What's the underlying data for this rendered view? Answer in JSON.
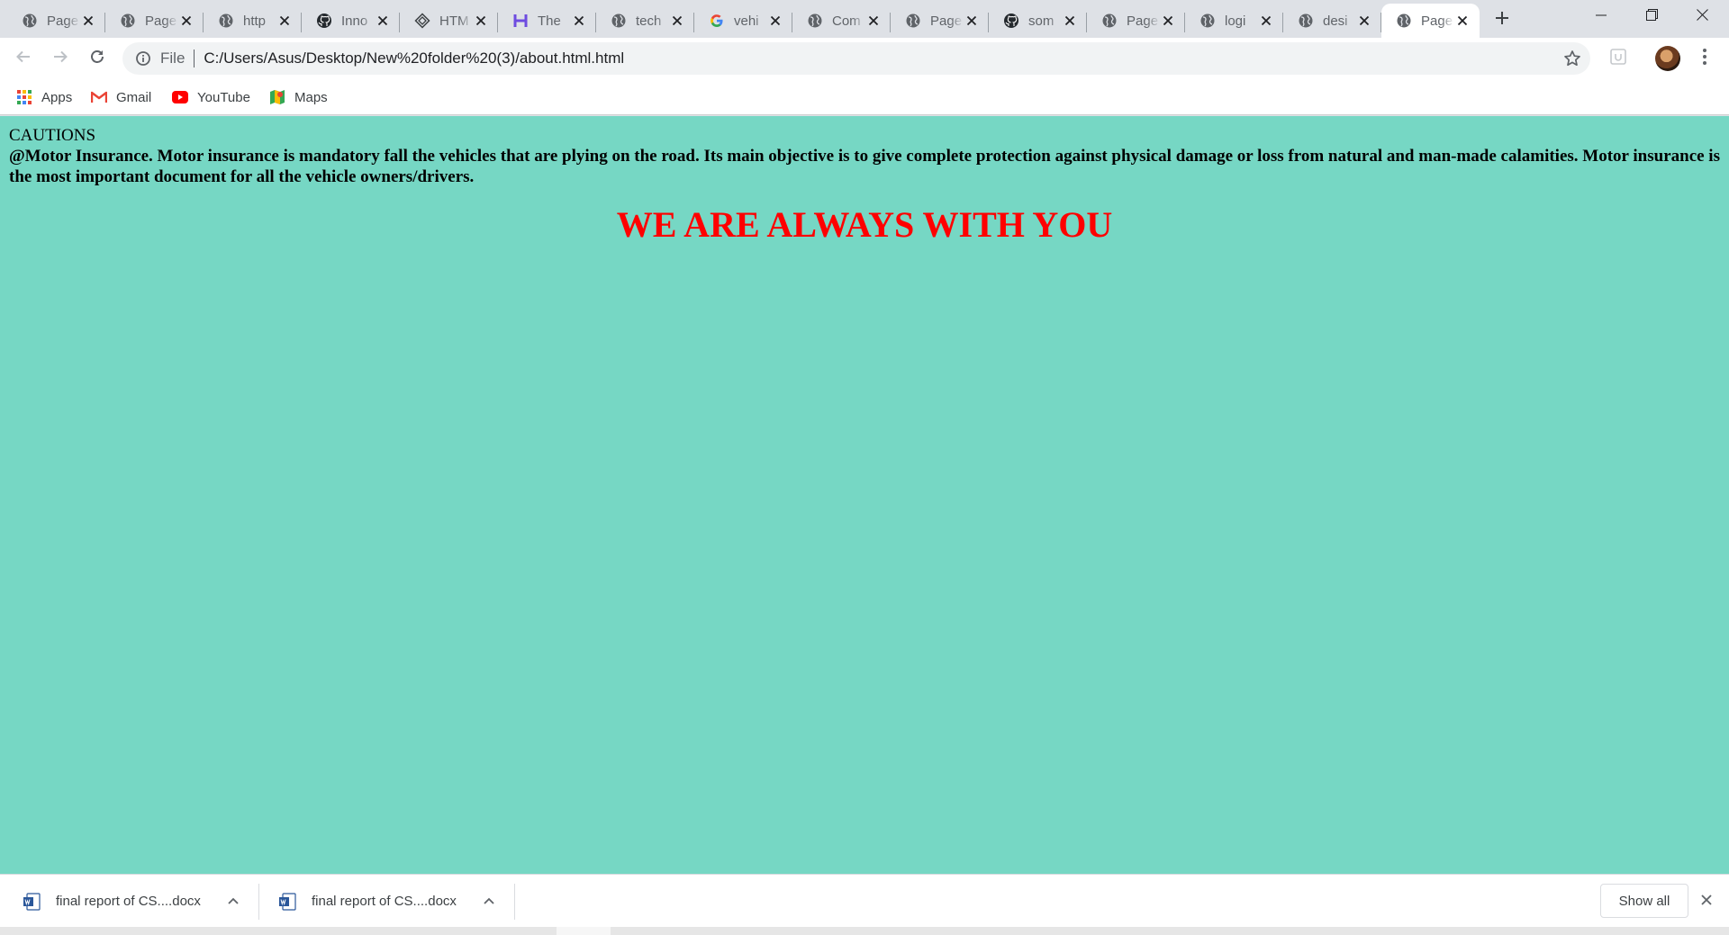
{
  "browser": {
    "tabs": [
      {
        "title": "Page",
        "icon": "globe-icon"
      },
      {
        "title": "Page",
        "icon": "globe-icon"
      },
      {
        "title": "http",
        "icon": "globe-icon"
      },
      {
        "title": "Inno",
        "icon": "github-icon"
      },
      {
        "title": "HTM",
        "icon": "diamond-icon"
      },
      {
        "title": "The",
        "icon": "h-logo-icon"
      },
      {
        "title": "tech",
        "icon": "globe-icon"
      },
      {
        "title": "vehi",
        "icon": "google-icon"
      },
      {
        "title": "Com",
        "icon": "globe-icon"
      },
      {
        "title": "Page",
        "icon": "globe-icon"
      },
      {
        "title": "som",
        "icon": "github-icon"
      },
      {
        "title": "Page",
        "icon": "globe-icon"
      },
      {
        "title": "logi",
        "icon": "globe-icon"
      },
      {
        "title": "desi",
        "icon": "globe-icon"
      },
      {
        "title": "Page",
        "icon": "globe-icon",
        "active": true
      }
    ],
    "address": {
      "scheme_label": "File",
      "url": "C:/Users/Asus/Desktop/New%20folder%20(3)/about.html.html"
    },
    "bookmarks": [
      {
        "label": "Apps",
        "icon": "apps-grid-icon"
      },
      {
        "label": "Gmail",
        "icon": "gmail-icon"
      },
      {
        "label": "YouTube",
        "icon": "youtube-icon"
      },
      {
        "label": "Maps",
        "icon": "maps-icon"
      }
    ]
  },
  "page": {
    "background": "#76d7c4",
    "cautions_label": "CAUTIONS",
    "paragraph": "@Motor Insurance. Motor insurance is mandatory fall the vehicles that are plying on the road. Its main objective is to give complete protection against physical damage or loss from natural and man-made calamities. Motor insurance is the most important document for all the vehicle owners/drivers.",
    "headline": "WE ARE ALWAYS WITH YOU",
    "headline_color": "#ff0000"
  },
  "downloads": {
    "items": [
      {
        "name": "final report of CS....docx",
        "icon": "word-doc-icon"
      },
      {
        "name": "final report of CS....docx",
        "icon": "word-doc-icon"
      }
    ],
    "show_all_label": "Show all"
  }
}
